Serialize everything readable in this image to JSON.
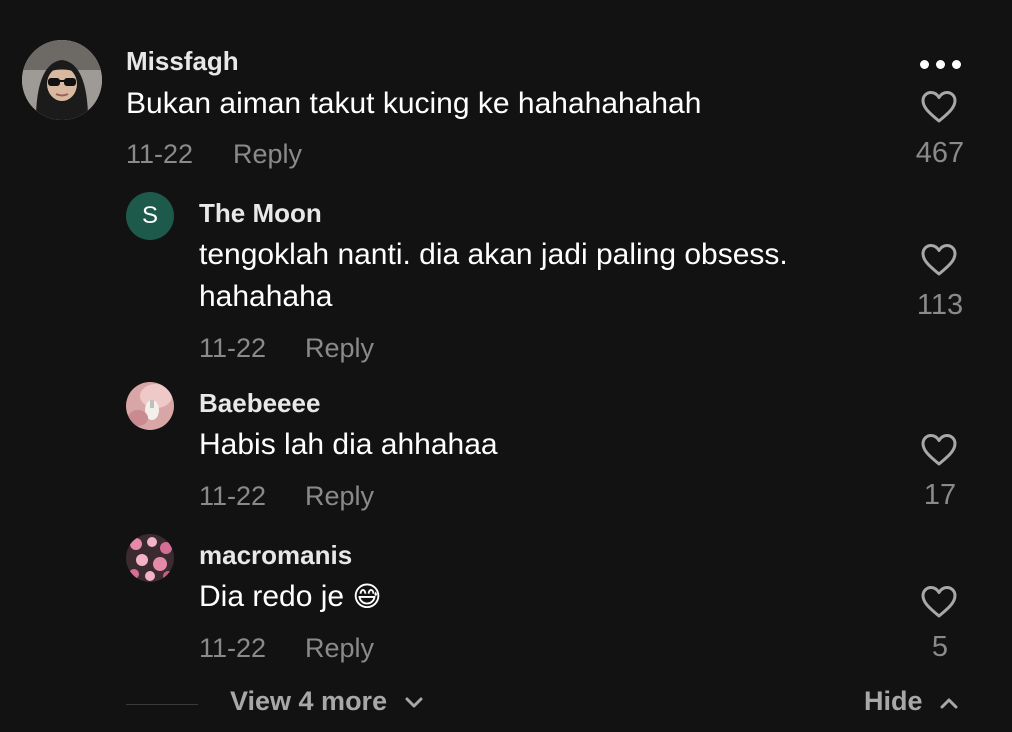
{
  "comments": [
    {
      "username": "Missfagh",
      "text": "Bukan aiman takut kucing ke hahahahahah",
      "date": "11-22",
      "reply_label": "Reply",
      "likes": "467",
      "avatar_icon": "profile-photo-hijab-sunglasses"
    }
  ],
  "replies": [
    {
      "username": "The Moon",
      "text_line1": "tengoklah nanti. dia akan jadi paling obsess.",
      "text_line2": "hahahaha",
      "date": "11-22",
      "reply_label": "Reply",
      "likes": "113",
      "avatar_letter": "S",
      "avatar_color": "#1e5a4c"
    },
    {
      "username": "Baebeeee",
      "text": "Habis lah dia ahhahaa",
      "date": "11-22",
      "reply_label": "Reply",
      "likes": "17",
      "avatar_icon": "profile-photo-pink"
    },
    {
      "username": "macromanis",
      "text": "Dia redo je",
      "emoji": "😅",
      "date": "11-22",
      "reply_label": "Reply",
      "likes": "5",
      "avatar_icon": "profile-photo-flowers"
    }
  ],
  "footer": {
    "view_more_label": "View 4 more",
    "hide_label": "Hide"
  },
  "colors": {
    "background": "#121212",
    "secondary_text": "#8a8a8a"
  }
}
